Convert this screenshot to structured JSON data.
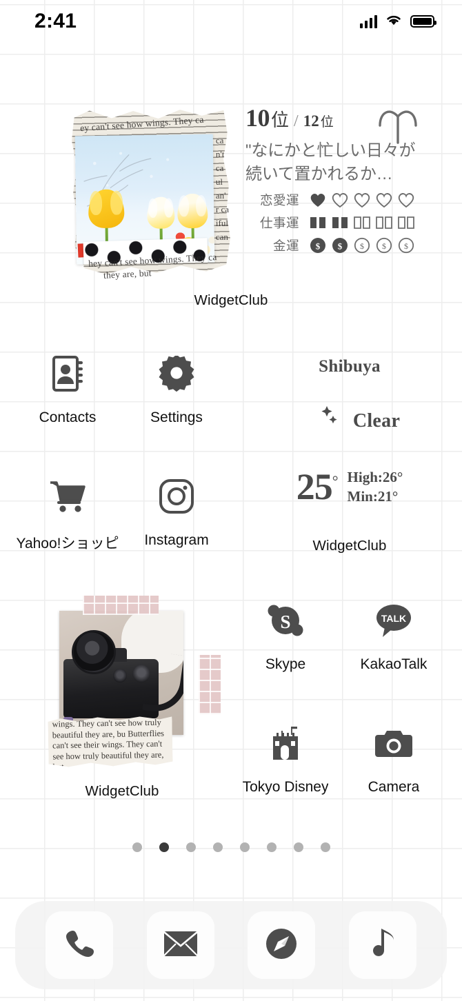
{
  "status_bar": {
    "time": "2:41",
    "signal_icon": "cellular-signal-icon",
    "wifi_icon": "wifi-icon",
    "battery_icon": "battery-full-icon"
  },
  "widgets": {
    "photo_collage": {
      "label": "WidgetClub",
      "newspaper_top": "ey can't  see how  wings. They ca",
      "newspaper_bottom_1": "hey can't see how  wings. They ca",
      "newspaper_bottom_2": "they are, but",
      "newspaper_column": "ca\nn't\nca\nul\nan'\nr ca\niful\ncan"
    },
    "horoscope": {
      "rank_value": "10",
      "rank_unit": "位",
      "separator": "/",
      "total_value": "12",
      "total_unit": "位",
      "zodiac_sign": "aries-icon",
      "quote": "\"なにかと忙しい日々が続いて置かれるか…",
      "ratings": [
        {
          "label": "恋愛運",
          "icon": "heart-icon",
          "filled": 1,
          "total": 5
        },
        {
          "label": "仕事運",
          "icon": "book-icon",
          "filled": 2,
          "total": 5
        },
        {
          "label": "金運",
          "icon": "coin-icon",
          "filled": 2,
          "total": 5
        }
      ]
    },
    "weather": {
      "city": "Shibuya",
      "condition_icon": "moon-stars-icon",
      "condition": "Clear",
      "temperature": "25",
      "degree": "°",
      "high": "High:26°",
      "low": "Min:21°",
      "label": "WidgetClub"
    },
    "camera_collage": {
      "label": "WidgetClub",
      "note_text": "wings. They can't see how truly beautiful they are, bu Butterflies can't see their wings. They can't see how truly beautiful they are, but"
    }
  },
  "apps": [
    {
      "name": "Contacts",
      "icon": "contacts-icon"
    },
    {
      "name": "Settings",
      "icon": "gear-icon"
    },
    {
      "name": "Yahoo!ショッピ",
      "icon": "shopping-cart-icon"
    },
    {
      "name": "Instagram",
      "icon": "instagram-icon"
    },
    {
      "name": "Skype",
      "icon": "skype-icon"
    },
    {
      "name": "KakaoTalk",
      "icon": "kakaotalk-icon",
      "badge_text": "TALK"
    },
    {
      "name": "Tokyo Disney ",
      "icon": "castle-icon"
    },
    {
      "name": "Camera",
      "icon": "camera-icon"
    }
  ],
  "page_dots": {
    "total": 8,
    "active_index": 1
  },
  "dock": [
    {
      "name": "Phone",
      "icon": "phone-icon"
    },
    {
      "name": "Mail",
      "icon": "mail-icon"
    },
    {
      "name": "Safari",
      "icon": "compass-icon"
    },
    {
      "name": "Music",
      "icon": "music-note-icon"
    }
  ],
  "colors": {
    "icon_gray": "#4d4d4d",
    "label_black": "#111111",
    "grid_line": "#ededed",
    "dock_bg": "#f2f2f2",
    "dot_active": "#3a3a3a",
    "dot_inactive": "#b2b2b2"
  }
}
